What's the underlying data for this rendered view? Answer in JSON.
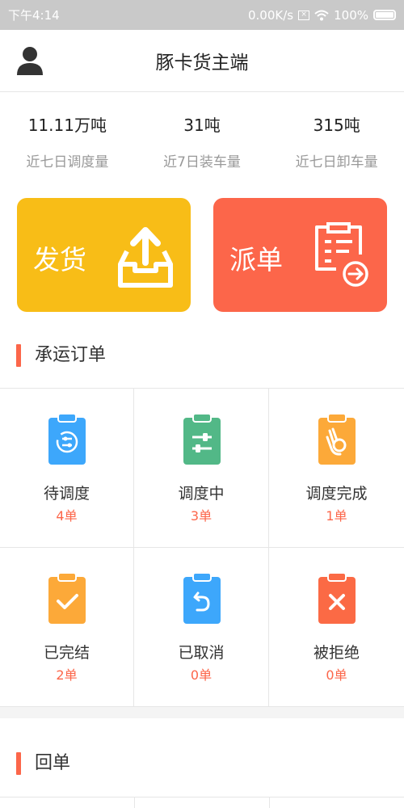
{
  "status_bar": {
    "time": "下午4:14",
    "network_speed": "0.00K/s",
    "battery": "100%"
  },
  "header": {
    "title": "豚卡货主端"
  },
  "stats": [
    {
      "value": "11.11万吨",
      "label": "近七日调度量"
    },
    {
      "value": "31吨",
      "label": "近7日装车量"
    },
    {
      "value": "315吨",
      "label": "近七日卸车量"
    }
  ],
  "actions": {
    "ship_label": "发货",
    "dispatch_label": "派单",
    "ship_color": "#f8bd17",
    "dispatch_color": "#fc664a"
  },
  "orders_section": {
    "title": "承运订单",
    "items": [
      {
        "name": "待调度",
        "count": "4单",
        "icon": "pending-clipboard-icon",
        "color": "#3da7fb"
      },
      {
        "name": "调度中",
        "count": "3单",
        "icon": "sliders-clipboard-icon",
        "color": "#52b887"
      },
      {
        "name": "调度完成",
        "count": "1单",
        "icon": "ok-hand-clipboard-icon",
        "color": "#fca939"
      },
      {
        "name": "已完结",
        "count": "2单",
        "icon": "check-clipboard-icon",
        "color": "#fca939"
      },
      {
        "name": "已取消",
        "count": "0单",
        "icon": "undo-clipboard-icon",
        "color": "#3da7fb"
      },
      {
        "name": "被拒绝",
        "count": "0单",
        "icon": "x-clipboard-icon",
        "color": "#fb6a45"
      }
    ]
  },
  "receipt_section": {
    "title": "回单"
  },
  "colors": {
    "accent": "#fc664a",
    "count_text": "#fc664a"
  }
}
